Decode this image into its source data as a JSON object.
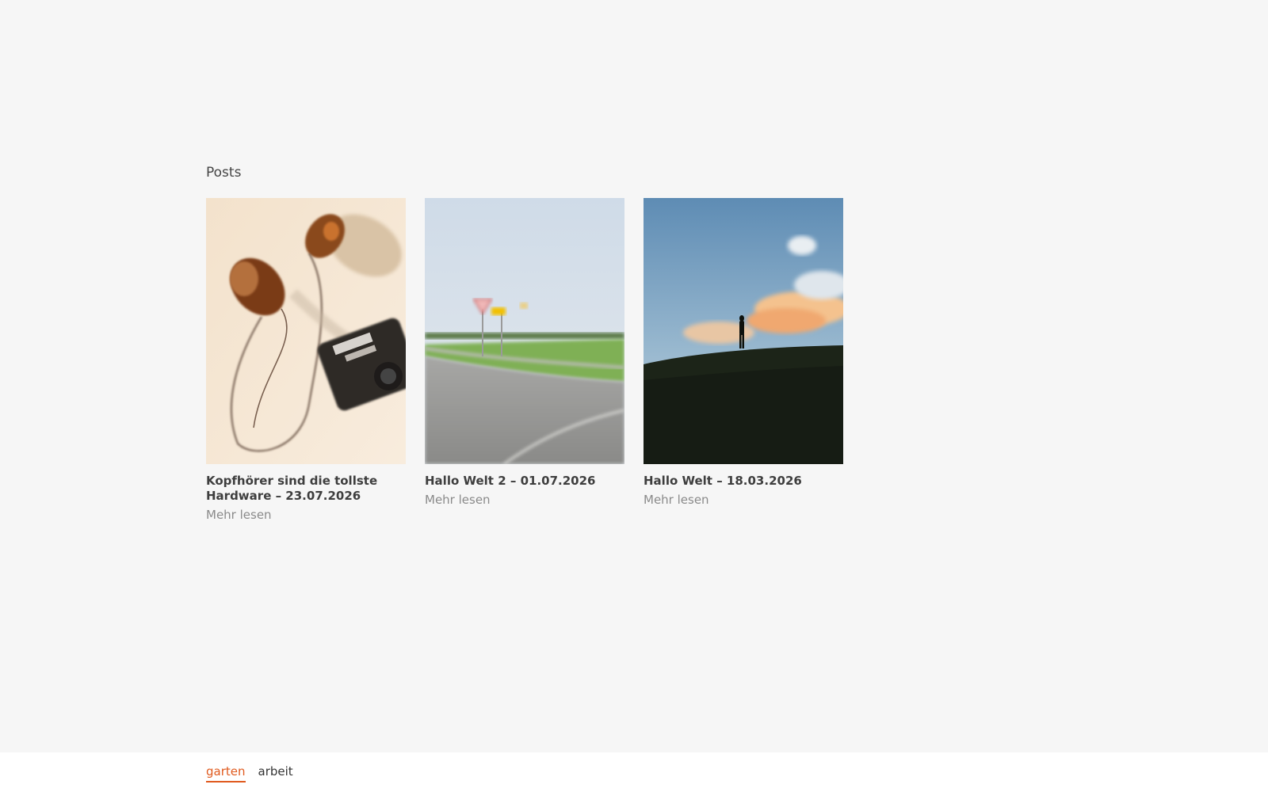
{
  "posts": {
    "section_title": "Posts",
    "items": [
      {
        "title": "Kopfhörer sind die tollste Hardware – 23.07.2026",
        "read_more": "Mehr lesen",
        "image_alt": "headphones-and-camera-photo"
      },
      {
        "title": "Hallo Welt 2 – 01.07.2026",
        "read_more": "Mehr lesen",
        "image_alt": "blurred-road-landscape-photo"
      },
      {
        "title": "Hallo Welt – 18.03.2026",
        "read_more": "Mehr lesen",
        "image_alt": "silhouette-sunset-photo"
      }
    ]
  },
  "footer_nav": {
    "items": [
      {
        "label": "garten",
        "active": true
      },
      {
        "label": "arbeit",
        "active": false
      }
    ]
  },
  "colors": {
    "accent": "#e05a1e",
    "background": "#f6f6f6"
  }
}
